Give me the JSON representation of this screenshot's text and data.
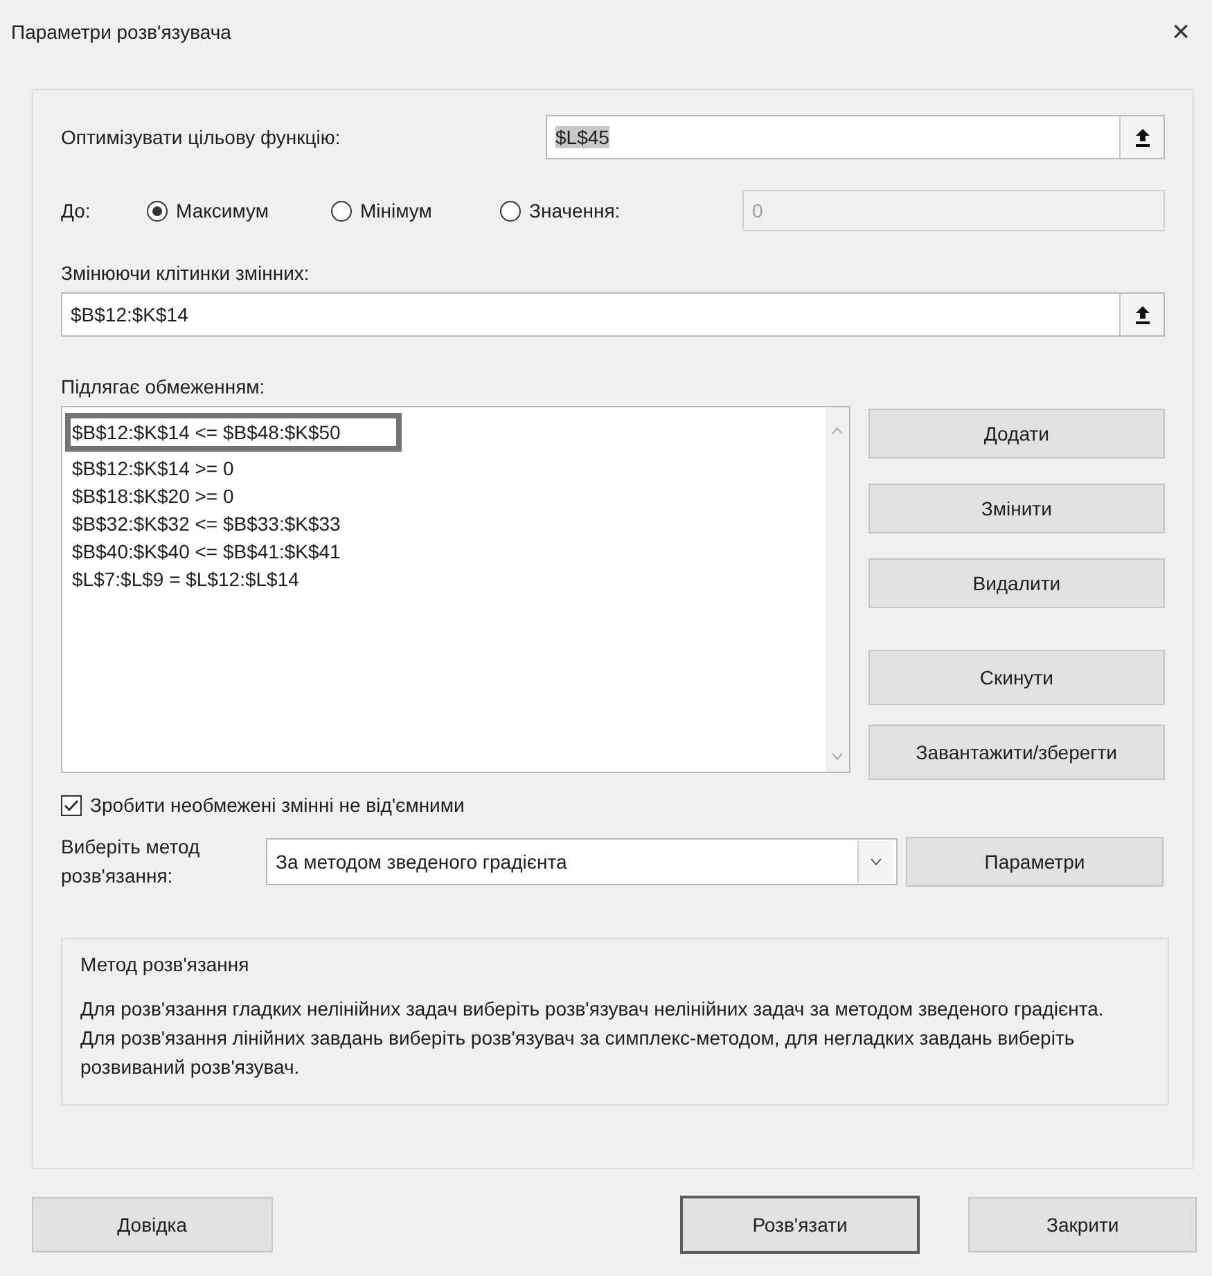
{
  "window": {
    "title": "Параметри розв'язувача",
    "close": "×"
  },
  "objective": {
    "label": "Оптимізувати цільову функцію:",
    "value": "$L$45",
    "value_selected": true
  },
  "to": {
    "label": "До:",
    "options": [
      {
        "label": "Максимум",
        "selected": true
      },
      {
        "label": "Мінімум",
        "selected": false
      },
      {
        "label": "Значення:",
        "selected": false
      }
    ],
    "value_field": {
      "value": "0",
      "disabled": true
    }
  },
  "variables": {
    "label": "Змінюючи клітинки змінних:",
    "value": "$B$12:$K$14"
  },
  "constraints": {
    "label": "Підлягає обмеженням:",
    "items": [
      {
        "text": "$B$12:$K$14 <= $B$48:$K$50",
        "highlighted": true
      },
      {
        "text": "$B$12:$K$14 >= 0",
        "highlighted": false
      },
      {
        "text": "$B$18:$K$20 >= 0",
        "highlighted": false
      },
      {
        "text": "$B$32:$K$32 <= $B$33:$K$33",
        "highlighted": false
      },
      {
        "text": "$B$40:$K$40 <= $B$41:$K$41",
        "highlighted": false
      },
      {
        "text": "$L$7:$L$9 = $L$12:$L$14",
        "highlighted": false
      }
    ],
    "buttons": [
      "Додати",
      "Змінити",
      "Видалити",
      "Скинути",
      "Завантажити/зберегти"
    ]
  },
  "nonnegative": {
    "label": "Зробити необмежені змінні не від'ємними",
    "checked": true
  },
  "method": {
    "label": "Виберіть метод розв'язання:",
    "value": "За методом зведеного градієнта",
    "button": "Параметри"
  },
  "description": {
    "title": "Метод розв'язання",
    "text": "Для розв'язання гладких нелінійних задач виберіть розв'язувач нелінійних задач за методом зведеного градієнта. Для розв'язання лінійних завдань виберіть розв'язувач за симплекс-методом, для негладких завдань виберіть розвиваний розв'язувач."
  },
  "footer": [
    {
      "label": "Довідка",
      "kind": "help"
    },
    {
      "label": "Розв'язати",
      "kind": "default"
    },
    {
      "label": "Закрити",
      "kind": "normal"
    }
  ]
}
